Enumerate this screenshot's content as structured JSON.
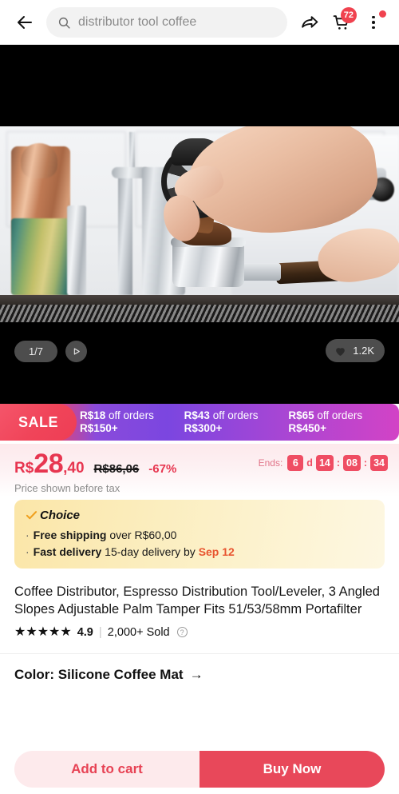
{
  "topbar": {
    "back_icon": "arrow-left-icon",
    "search": {
      "value": "distributor tool coffee",
      "placeholder": "Search",
      "icon": "search-icon"
    },
    "share_icon": "share-icon",
    "cart": {
      "icon": "cart-icon",
      "badge": "72"
    },
    "menu": {
      "icon": "more-vertical-icon",
      "has_notification_dot": true
    }
  },
  "media": {
    "counter": "1/7",
    "play_icon": "play-icon",
    "likes": {
      "icon": "heart-icon",
      "count": "1.2K"
    }
  },
  "sale_banner": {
    "tag": "SALE",
    "offers": [
      {
        "amount": "R$18",
        "text": " off orders",
        "threshold": "R$150+"
      },
      {
        "amount": "R$43",
        "text": " off orders",
        "threshold": "R$300+"
      },
      {
        "amount": "R$65",
        "text": " off orders",
        "threshold": "R$450+"
      }
    ]
  },
  "price": {
    "currency": "R$",
    "integer": "28",
    "decimal": ",40",
    "original": "R$86,06",
    "discount": "-67%",
    "note": "Price shown before tax",
    "timer": {
      "label": "Ends:",
      "days": "6",
      "days_unit": "d",
      "hours": "14",
      "minutes": "08",
      "seconds": "34",
      "sep": ":"
    }
  },
  "choice": {
    "check_icon": "check-icon",
    "label": "Choice",
    "lines": [
      {
        "bullet": "·",
        "bold": "Free shipping",
        "rest": " over R$60,00",
        "highlight": ""
      },
      {
        "bullet": "·",
        "bold": "Fast delivery",
        "rest": " 15-day delivery by ",
        "highlight": "Sep 12"
      }
    ]
  },
  "product": {
    "title": "Coffee Distributor, Espresso Distribution Tool/Leveler, 3 Angled Slopes Adjustable Palm Tamper Fits 51/53/58mm Portafilter",
    "stars": "★★★★★",
    "rating": "4.9",
    "divider": "|",
    "sold": "2,000+ Sold",
    "info_icon": "question-mark-icon"
  },
  "color_section": {
    "label": "Color: Silicone Coffee Mat",
    "arrow": "→"
  },
  "bottombar": {
    "add_to_cart": "Add to cart",
    "buy_now": "Buy Now"
  },
  "colors": {
    "accent_red": "#e8485a",
    "price_red": "#e73650",
    "sale_purple": "#8a4bdb",
    "choice_yellow": "#fbe6a8",
    "date_orange": "#e8542f"
  }
}
